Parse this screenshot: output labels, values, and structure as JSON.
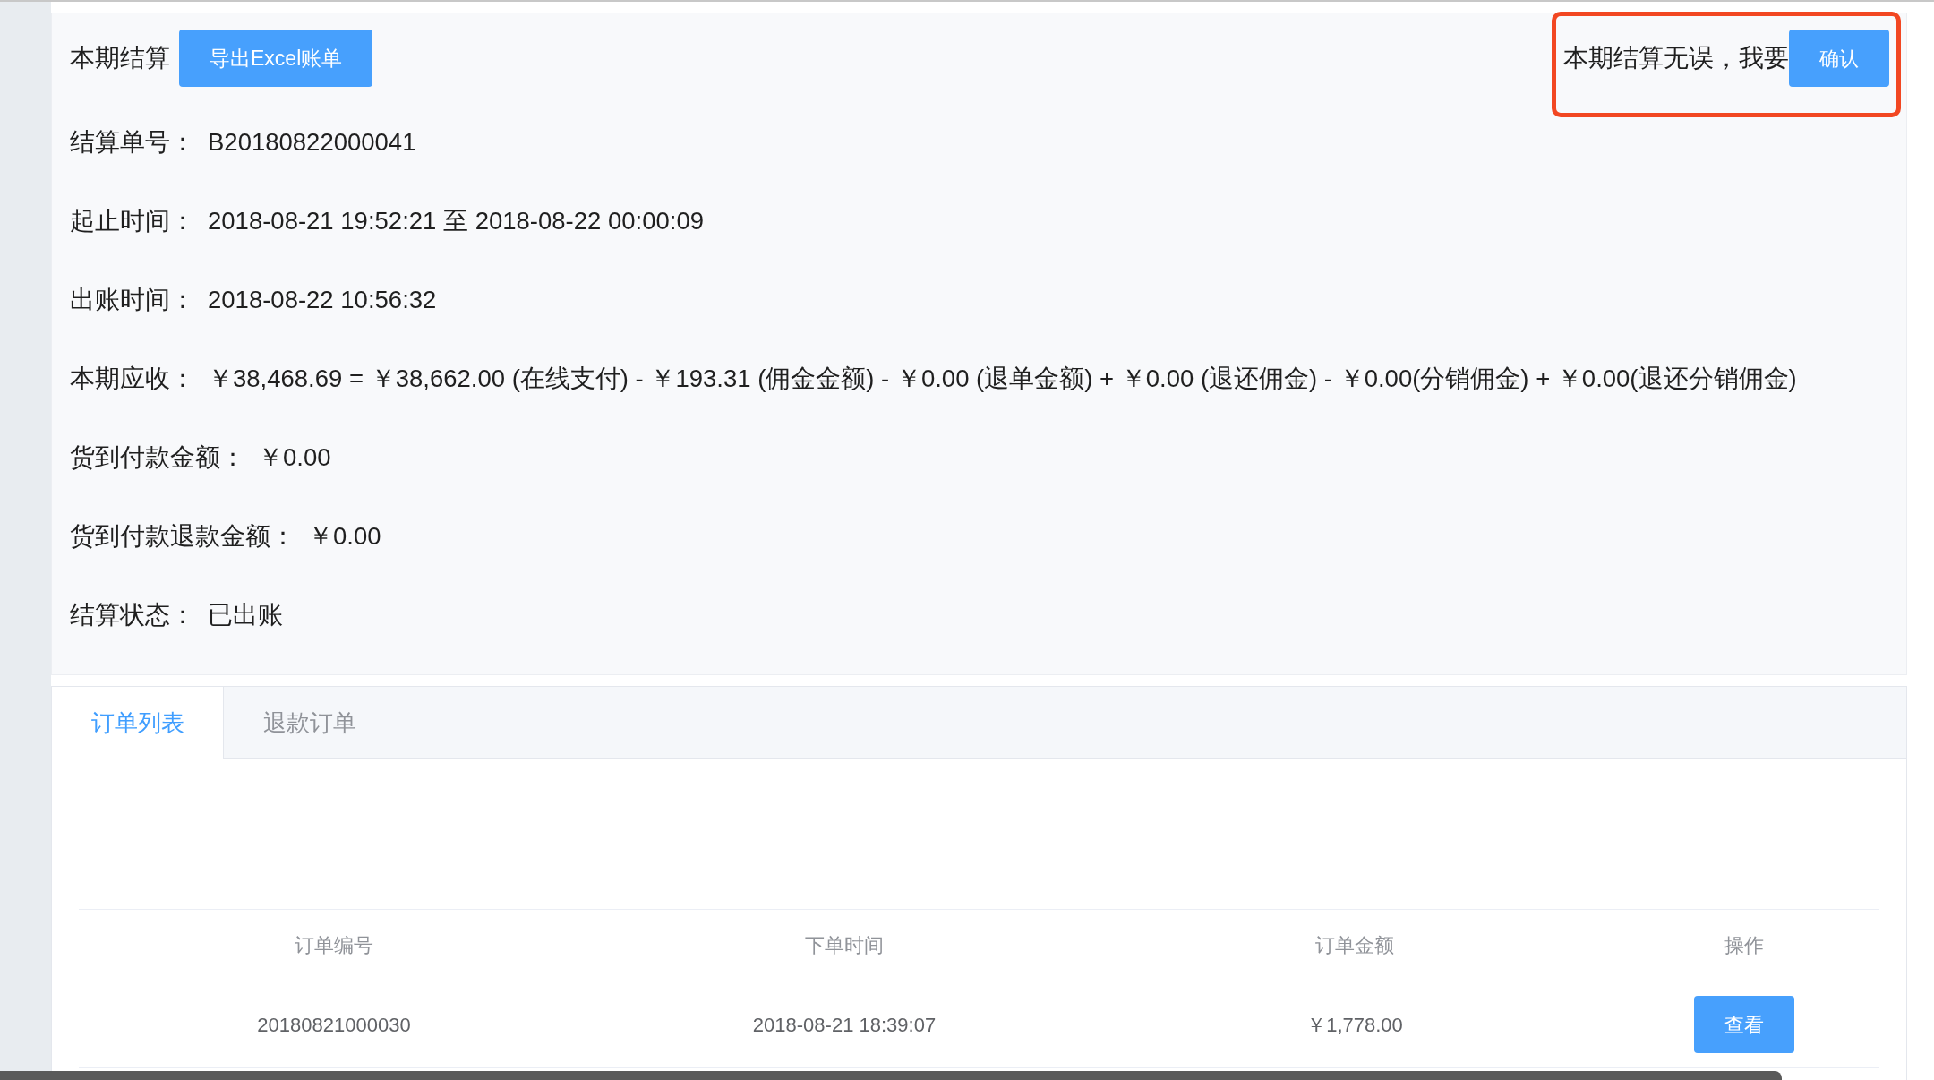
{
  "header": {
    "title": "本期结算",
    "export_button": "导出Excel账单",
    "confirm_prompt": "本期结算无误，我要",
    "confirm_button": "确认"
  },
  "fields": [
    {
      "label": "结算单号：",
      "value": "B20180822000041"
    },
    {
      "label": "起止时间：",
      "value": "2018-08-21 19:52:21 至 2018-08-22 00:00:09"
    },
    {
      "label": "出账时间：",
      "value": "2018-08-22 10:56:32"
    },
    {
      "label": "本期应收：",
      "value": "￥38,468.69 = ￥38,662.00 (在线支付) - ￥193.31 (佣金金额) - ￥0.00 (退单金额) + ￥0.00 (退还佣金) - ￥0.00(分销佣金) + ￥0.00(退还分销佣金)"
    },
    {
      "label": "货到付款金额：",
      "value": "￥0.00"
    },
    {
      "label": "货到付款退款金额：",
      "value": "￥0.00"
    },
    {
      "label": "结算状态：",
      "value": "已出账"
    }
  ],
  "tabs": [
    {
      "label": "订单列表",
      "selected": true
    },
    {
      "label": "退款订单",
      "selected": false
    }
  ],
  "table": {
    "columns": [
      "订单编号",
      "下单时间",
      "订单金额",
      "操作"
    ],
    "rows": [
      {
        "cells": [
          "20180821000030",
          "2018-08-21 18:39:07",
          "￥1,778.00"
        ],
        "action": "查看"
      }
    ]
  }
}
